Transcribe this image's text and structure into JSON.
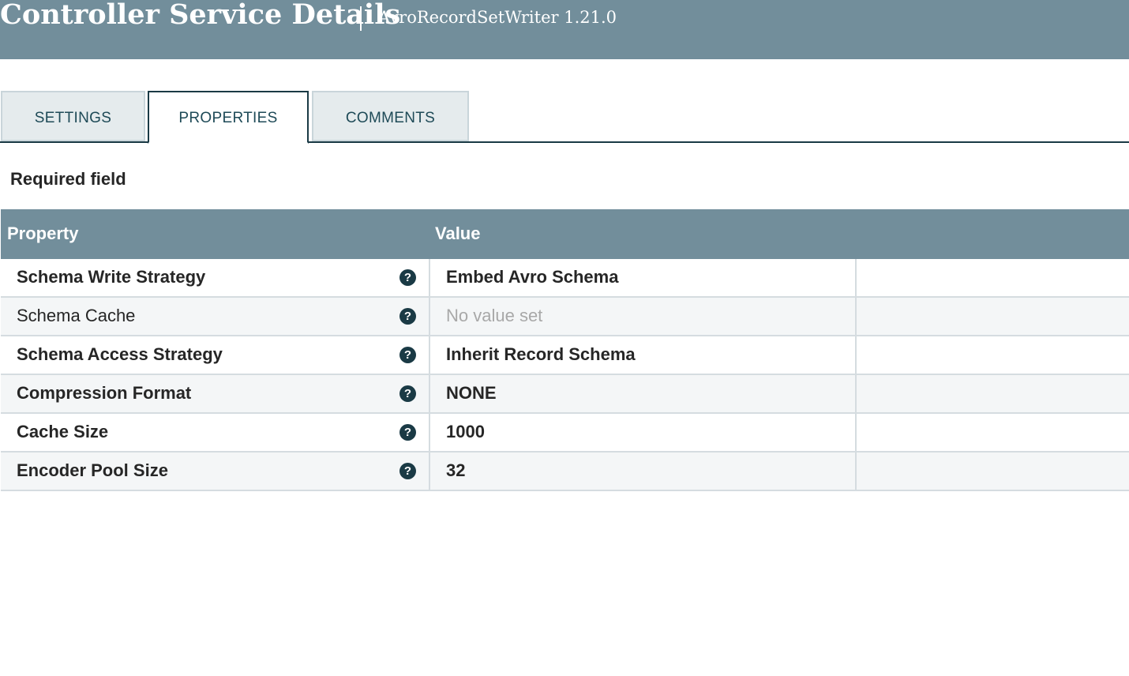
{
  "header": {
    "title": "Controller Service Details",
    "subtitle": "AvroRecordSetWriter 1.21.0"
  },
  "tabs": [
    {
      "label": "SETTINGS",
      "active": false
    },
    {
      "label": "PROPERTIES",
      "active": true
    },
    {
      "label": "COMMENTS",
      "active": false
    }
  ],
  "required_label": "Required field",
  "table": {
    "columns": [
      "Property",
      "Value"
    ],
    "rows": [
      {
        "name": "Schema Write Strategy",
        "required": true,
        "value": "Embed Avro Schema",
        "has_value": true
      },
      {
        "name": "Schema Cache",
        "required": false,
        "value": "No value set",
        "has_value": false
      },
      {
        "name": "Schema Access Strategy",
        "required": true,
        "value": "Inherit Record Schema",
        "has_value": true
      },
      {
        "name": "Compression Format",
        "required": true,
        "value": "NONE",
        "has_value": true
      },
      {
        "name": "Cache Size",
        "required": true,
        "value": "1000",
        "has_value": true
      },
      {
        "name": "Encoder Pool Size",
        "required": true,
        "value": "32",
        "has_value": true
      }
    ]
  },
  "icons": {
    "help": "question-circle-icon",
    "help_glyph": "?"
  },
  "colors": {
    "header_bg": "#728e9b",
    "accent_dark": "#1a3a45",
    "tab_inactive_bg": "#e5ebed",
    "row_alt_bg": "#f4f6f7",
    "empty_value": "#a8a8a8"
  }
}
